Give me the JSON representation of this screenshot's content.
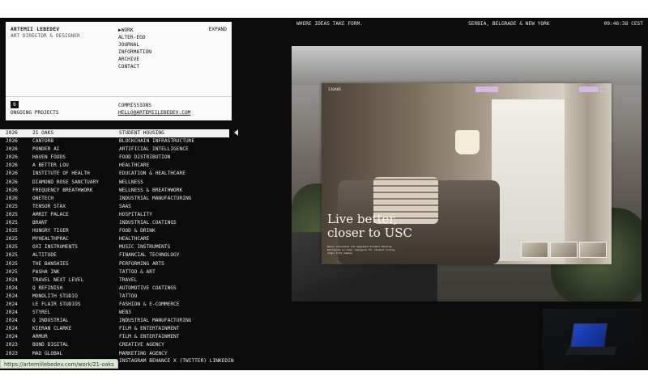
{
  "header": {
    "name": "ARTEMII LEBEDEV",
    "role": "ART DIRECTOR & DESIGNER",
    "nav": [
      "WORK",
      "ALTER-EGO",
      "JOURNAL",
      "INFORMATION",
      "ARCHIVE",
      "CONTACT"
    ],
    "nav_active_marker": "▶",
    "expand_label": "EXPAND",
    "ongoing_count": "6",
    "ongoing_label": "ONGOING PROJECTS",
    "commissions_label": "COMMISSIONS",
    "commissions_email": "HELLO@ARTEMIILEBEDEV.COM"
  },
  "topbar": {
    "tagline": "WHERE IDEAS TAKE FORM.",
    "location": "SERBIA, BELGRADE & NEW YORK",
    "clock": "09:46:38 CEST"
  },
  "projects": [
    {
      "year": "2026",
      "name": "21 OAKS",
      "category": "STUDENT HOUSING",
      "active": true
    },
    {
      "year": "2026",
      "name": "CANTORB",
      "category": "BLOCKCHAIN INFRASTRUCTURE"
    },
    {
      "year": "2026",
      "name": "PONDER AI",
      "category": "ARTIFICIAL INTELLIGENCE"
    },
    {
      "year": "2026",
      "name": "HAVEN FOODS",
      "category": "FOOD DISTRIBUTION"
    },
    {
      "year": "2026",
      "name": "A BETTER LOU",
      "category": "HEALTHCARE"
    },
    {
      "year": "2026",
      "name": "INSTITUTE OF HEALTH",
      "category": "EDUCATION & HEALTHCARE"
    },
    {
      "year": "2026",
      "name": "DIAMOND ROSE SANCTUARY",
      "category": "WELLNESS"
    },
    {
      "year": "2026",
      "name": "FREQUENCY BREATHWORK",
      "category": "WELLNESS & BREATHWORK"
    },
    {
      "year": "2026",
      "name": "ONETECH",
      "category": "INDUSTRIAL MANUFACTURING"
    },
    {
      "year": "2025",
      "name": "TENSOR STAX",
      "category": "SAAS"
    },
    {
      "year": "2025",
      "name": "AMRIT PALACE",
      "category": "HOSPITALITY"
    },
    {
      "year": "2025",
      "name": "BRANT",
      "category": "INDUSTRIAL COATINGS"
    },
    {
      "year": "2025",
      "name": "HUNGRY TIGER",
      "category": "FOOD & DRINK"
    },
    {
      "year": "2025",
      "name": "MYHEALTHPRAC",
      "category": "HEALTHCARE"
    },
    {
      "year": "2025",
      "name": "OXI INSTRUMENTS",
      "category": "MUSIC INSTRUMENTS"
    },
    {
      "year": "2025",
      "name": "ALTITUDE",
      "category": "FINANCIAL TECHNOLOGY"
    },
    {
      "year": "2025",
      "name": "THE BANSHIES",
      "category": "PERFORMING ARTS"
    },
    {
      "year": "2025",
      "name": "PASHA INK",
      "category": "TATTOO & ART"
    },
    {
      "year": "2024",
      "name": "TRAVEL NEXT LEVEL",
      "category": "TRAVEL"
    },
    {
      "year": "2024",
      "name": "Q REFINISH",
      "category": "AUTOMOTIVE COATINGS"
    },
    {
      "year": "2024",
      "name": "MONOLITH STUDIO",
      "category": "TATTOO"
    },
    {
      "year": "2024",
      "name": "LE FLAIR STUDIOS",
      "category": "FASHION & E-COMMERCE"
    },
    {
      "year": "2024",
      "name": "STYREL",
      "category": "WEB3"
    },
    {
      "year": "2024",
      "name": "Q INDUSTRIAL",
      "category": "INDUSTRIAL MANUFACTURING"
    },
    {
      "year": "2024",
      "name": "KIERAN CLARKE",
      "category": "FILM & ENTERTAINMENT"
    },
    {
      "year": "2024",
      "name": "ARMUR",
      "category": "FILM & ENTERTAINMENT"
    },
    {
      "year": "2023",
      "name": "BOND DIGITAL",
      "category": "CREATIVE AGENCY"
    },
    {
      "year": "2023",
      "name": "MAD GLOBAL",
      "category": "MARKETING AGENCY"
    }
  ],
  "footer": {
    "links": "INSTAGRAM BEHANCE X (TWITTER) LINKEDIN",
    "status_url": "https://artemiilebedev.com/work/21-oaks"
  },
  "preview": {
    "site_logo": "21OAKS",
    "hero_line1": "Live better,",
    "hero_line2": "closer to USC",
    "hero_sub": "Newly renovated and upgraded Student Housing. Delivered on time. Designed for student living, steps from campus."
  }
}
